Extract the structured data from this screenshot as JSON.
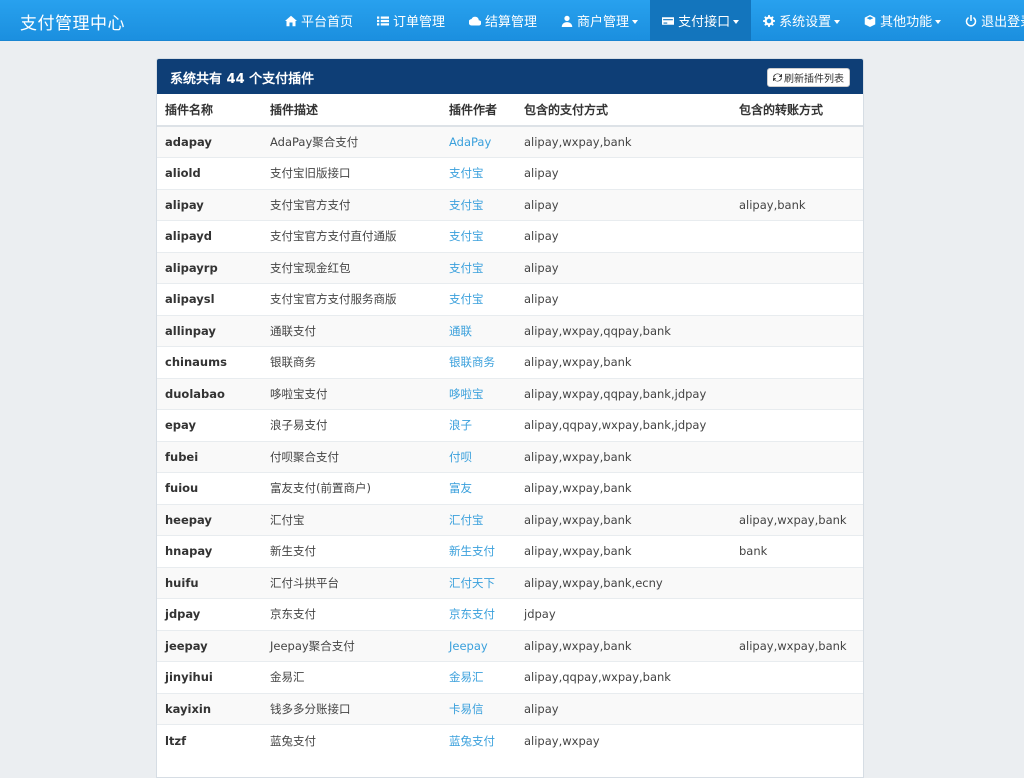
{
  "brand": "支付管理中心",
  "nav": [
    {
      "label": "平台首页",
      "icon": "home-icon",
      "dropdown": false,
      "active": false
    },
    {
      "label": "订单管理",
      "icon": "list-icon",
      "dropdown": false,
      "active": false
    },
    {
      "label": "结算管理",
      "icon": "cloud-icon",
      "dropdown": false,
      "active": false
    },
    {
      "label": "商户管理",
      "icon": "user-icon",
      "dropdown": true,
      "active": false
    },
    {
      "label": "支付接口",
      "icon": "credit-card-icon",
      "dropdown": true,
      "active": true
    },
    {
      "label": "系统设置",
      "icon": "gear-icon",
      "dropdown": true,
      "active": false
    },
    {
      "label": "其他功能",
      "icon": "cube-icon",
      "dropdown": true,
      "active": false
    },
    {
      "label": "退出登录",
      "icon": "power-icon",
      "dropdown": false,
      "active": false
    }
  ],
  "panel": {
    "title_prefix": "系统共有 ",
    "count": "44",
    "title_suffix": " 个支付插件",
    "refresh_label": "刷新插件列表"
  },
  "table": {
    "headers": [
      "插件名称",
      "插件描述",
      "插件作者",
      "包含的支付方式",
      "包含的转账方式"
    ],
    "rows": [
      [
        "adapay",
        "AdaPay聚合支付",
        "AdaPay",
        "alipay,wxpay,bank",
        ""
      ],
      [
        "aliold",
        "支付宝旧版接口",
        "支付宝",
        "alipay",
        ""
      ],
      [
        "alipay",
        "支付宝官方支付",
        "支付宝",
        "alipay",
        "alipay,bank"
      ],
      [
        "alipayd",
        "支付宝官方支付直付通版",
        "支付宝",
        "alipay",
        ""
      ],
      [
        "alipayrp",
        "支付宝现金红包",
        "支付宝",
        "alipay",
        ""
      ],
      [
        "alipaysl",
        "支付宝官方支付服务商版",
        "支付宝",
        "alipay",
        ""
      ],
      [
        "allinpay",
        "通联支付",
        "通联",
        "alipay,wxpay,qqpay,bank",
        ""
      ],
      [
        "chinaums",
        "银联商务",
        "银联商务",
        "alipay,wxpay,bank",
        ""
      ],
      [
        "duolabao",
        "哆啦宝支付",
        "哆啦宝",
        "alipay,wxpay,qqpay,bank,jdpay",
        ""
      ],
      [
        "epay",
        "浪子易支付",
        "浪子",
        "alipay,qqpay,wxpay,bank,jdpay",
        ""
      ],
      [
        "fubei",
        "付呗聚合支付",
        "付呗",
        "alipay,wxpay,bank",
        ""
      ],
      [
        "fuiou",
        "富友支付(前置商户)",
        "富友",
        "alipay,wxpay,bank",
        ""
      ],
      [
        "heepay",
        "汇付宝",
        "汇付宝",
        "alipay,wxpay,bank",
        "alipay,wxpay,bank"
      ],
      [
        "hnapay",
        "新生支付",
        "新生支付",
        "alipay,wxpay,bank",
        "bank"
      ],
      [
        "huifu",
        "汇付斗拱平台",
        "汇付天下",
        "alipay,wxpay,bank,ecny",
        ""
      ],
      [
        "jdpay",
        "京东支付",
        "京东支付",
        "jdpay",
        ""
      ],
      [
        "jeepay",
        "Jeepay聚合支付",
        "Jeepay",
        "alipay,wxpay,bank",
        "alipay,wxpay,bank"
      ],
      [
        "jinyihui",
        "金易汇",
        "金易汇",
        "alipay,qqpay,wxpay,bank",
        ""
      ],
      [
        "kayixin",
        "钱多多分账接口",
        "卡易信",
        "alipay",
        ""
      ],
      [
        "ltzf",
        "蓝兔支付",
        "蓝兔支付",
        "alipay,wxpay",
        ""
      ]
    ]
  }
}
